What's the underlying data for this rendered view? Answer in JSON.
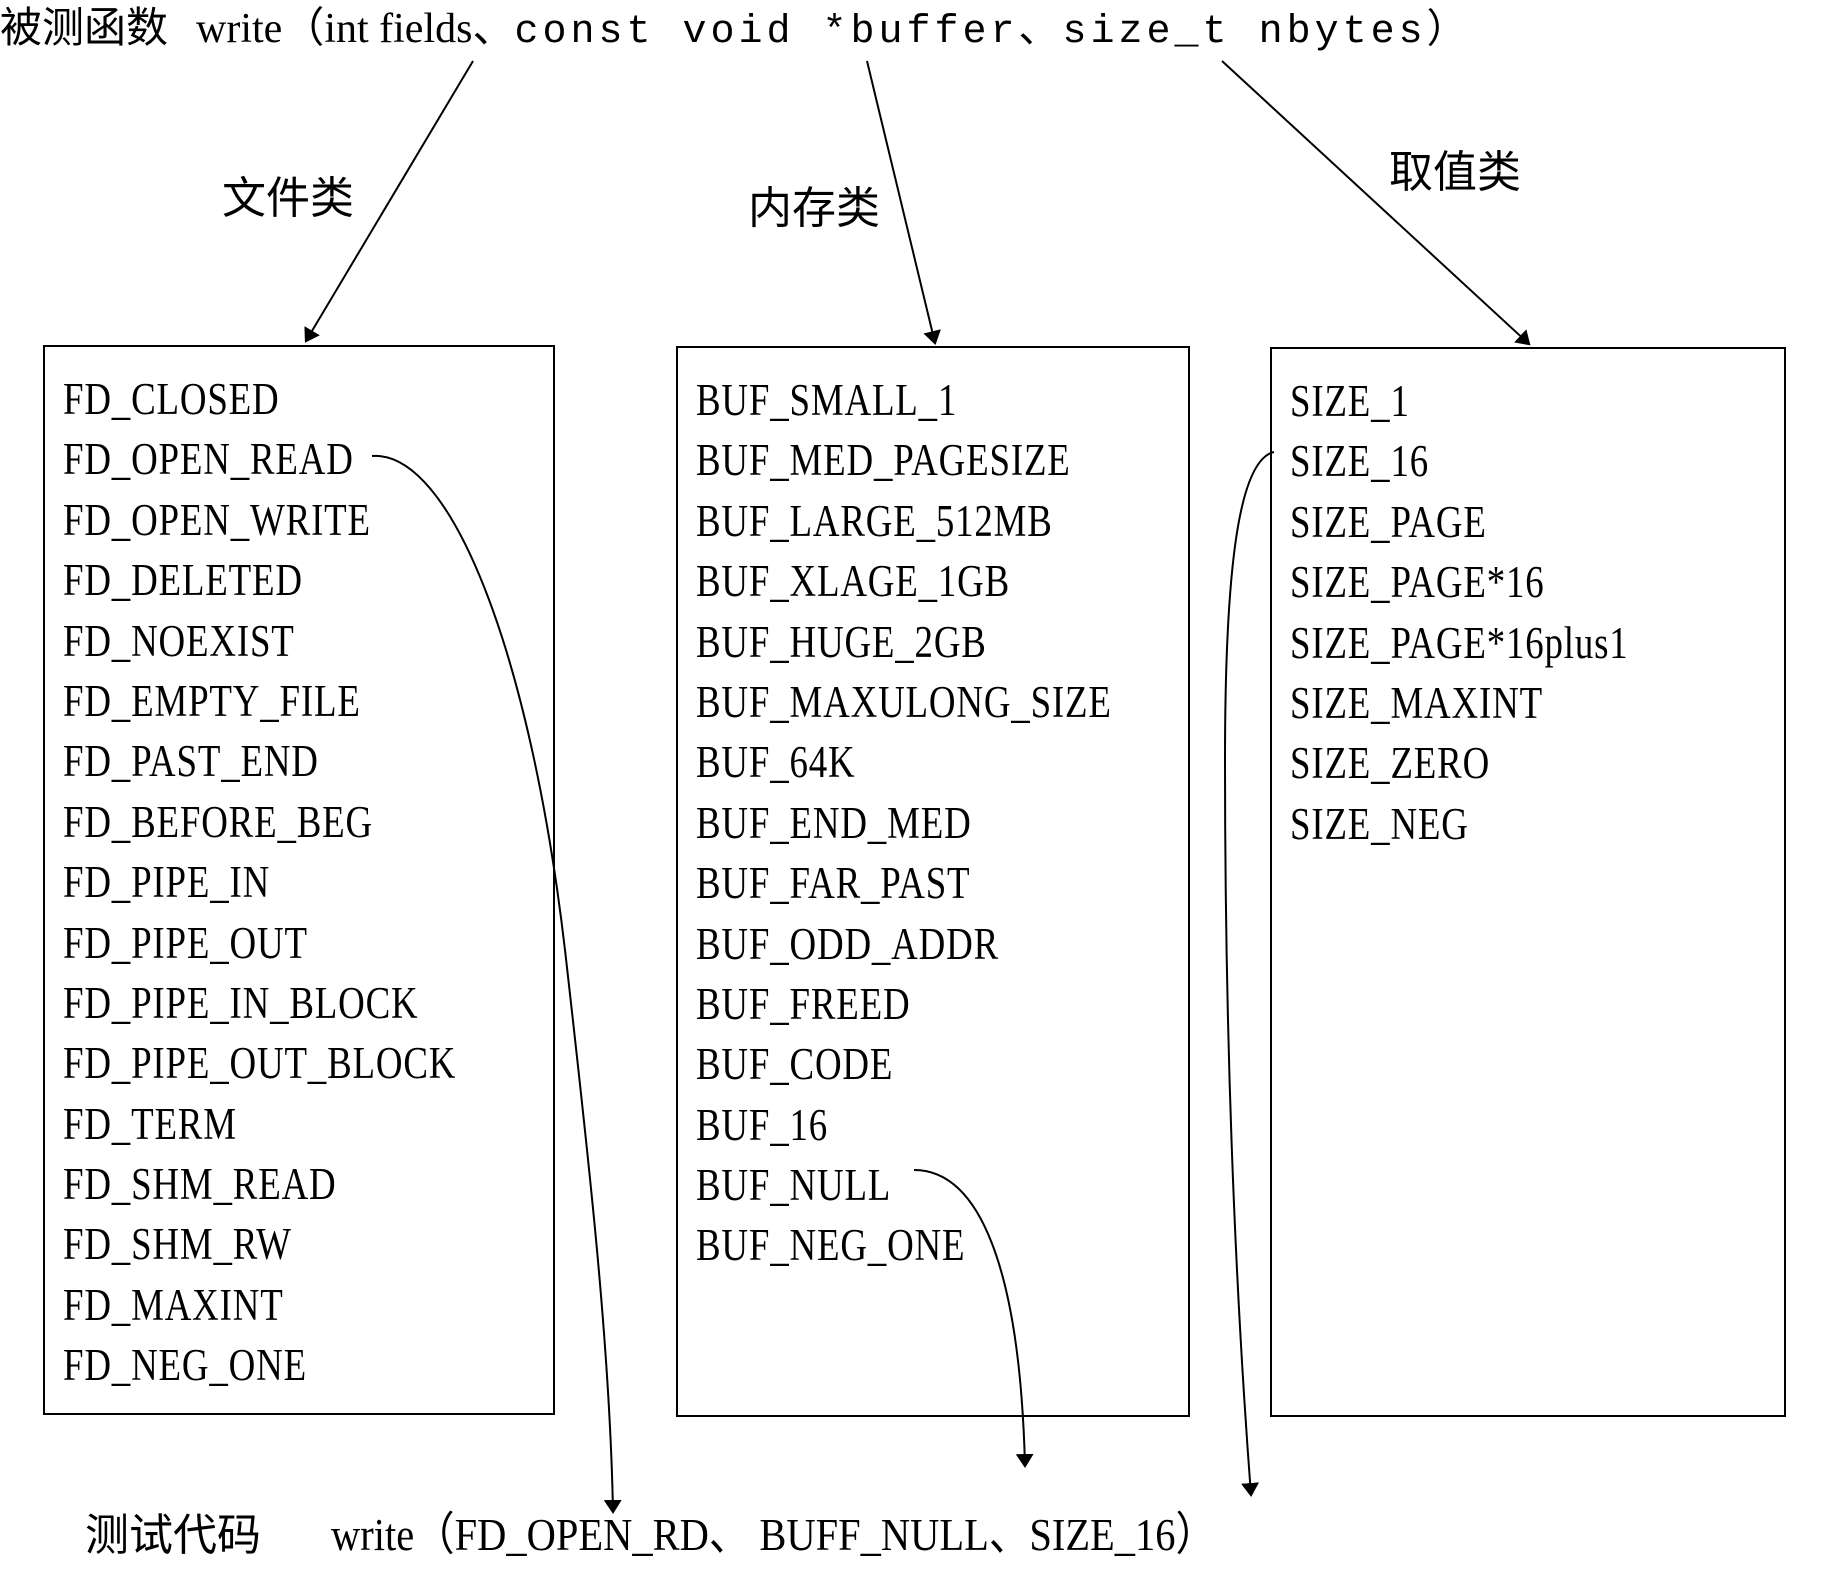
{
  "title": {
    "prefix": "被测函数",
    "function": "write（int fields、",
    "params": "const void *buffer、size_t nbytes）"
  },
  "categories": [
    {
      "label": "文件类",
      "items": [
        "FD_CLOSED",
        "FD_OPEN_READ",
        "FD_OPEN_WRITE",
        "FD_DELETED",
        "FD_NOEXIST",
        "FD_EMPTY_FILE",
        "FD_PAST_END",
        "FD_BEFORE_BEG",
        "FD_PIPE_IN",
        "FD_PIPE_OUT",
        "FD_PIPE_IN_BLOCK",
        "FD_PIPE_OUT_BLOCK",
        "FD_TERM",
        "FD_SHM_READ",
        "FD_SHM_RW",
        "FD_MAXINT",
        "FD_NEG_ONE"
      ]
    },
    {
      "label": "内存类",
      "items": [
        "BUF_SMALL_1",
        "BUF_MED_PAGESIZE",
        "BUF_LARGE_512MB",
        "BUF_XLAGE_1GB",
        "BUF_HUGE_2GB",
        "BUF_MAXULONG_SIZE",
        "BUF_64K",
        "BUF_END_MED",
        "BUF_FAR_PAST",
        "BUF_ODD_ADDR",
        "BUF_FREED",
        "BUF_CODE",
        "BUF_16",
        "BUF_NULL",
        "BUF_NEG_ONE"
      ]
    },
    {
      "label": "取值类",
      "items": [
        "SIZE_1",
        "SIZE_16",
        "SIZE_PAGE",
        "SIZE_PAGE*16",
        "SIZE_PAGE*16plus1",
        "SIZE_MAXINT",
        "SIZE_ZERO",
        "SIZE_NEG"
      ]
    }
  ],
  "selected": [
    "FD_OPEN_READ",
    "BUF_NULL",
    "SIZE_16"
  ],
  "test_code": {
    "label": "测试代码",
    "call": "write（FD_OPEN_RD、 BUFF_NULL、SIZE_16）"
  }
}
